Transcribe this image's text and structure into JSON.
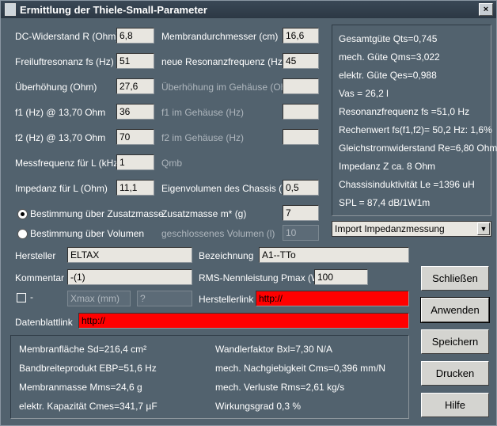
{
  "window": {
    "title": "Ermittlung der Thiele-Small-Parameter"
  },
  "left_fields": [
    {
      "label": "DC-Widerstand R (Ohm)",
      "value": "6,8"
    },
    {
      "label": "Freiluftresonanz fs (Hz)",
      "value": "51"
    },
    {
      "label": "Überhöhung (Ohm)",
      "value": "27,6"
    },
    {
      "label": "f1 (Hz) @ 13,70 Ohm",
      "value": "36"
    },
    {
      "label": "f2 (Hz) @ 13,70 Ohm",
      "value": "70"
    },
    {
      "label": "Messfrequenz für L (kHz)",
      "value": "1"
    },
    {
      "label": "Impedanz für L (Ohm)",
      "value": "11,1"
    }
  ],
  "mid_fields": [
    {
      "label": "Membrandurchmesser (cm)",
      "value": "16,6",
      "disabled": false
    },
    {
      "label": "neue Resonanzfrequenz (Hz)",
      "value": "45",
      "disabled": false
    },
    {
      "label": "Überhöhung im Gehäuse (Ohm)",
      "value": "",
      "disabled": true
    },
    {
      "label": "f1 im Gehäuse (Hz)",
      "value": "",
      "disabled": true
    },
    {
      "label": "f2 im Gehäuse (Hz)",
      "value": "",
      "disabled": true
    },
    {
      "label": "Qmb",
      "value": "",
      "disabled": true
    },
    {
      "label": "Eigenvolumen des Chassis (l)",
      "value": "0,5",
      "disabled": false
    }
  ],
  "results_right": [
    "Gesamtgüte Qts=0,745",
    "mech. Güte Qms=3,022",
    "elektr. Güte Qes=0,988",
    "Vas = 26,2 l",
    "Resonanzfrequenz fs =51,0 Hz",
    "Rechenwert fs(f1,f2)= 50,2 Hz: 1,6%",
    "Gleichstromwiderstand Re=6,80 Ohm",
    "Impedanz Z ca. 8 Ohm",
    "Chassisinduktivität Le =1396 uH",
    "SPL = 87,4 dB/1W1m"
  ],
  "radio": {
    "zusatz_label": "Bestimmung über Zusatzmasse",
    "volumen_label": "Bestimmung über Volumen",
    "zusatzmasse_label": "Zusatzmasse m* (g)",
    "zusatzmasse_value": "7",
    "volumen_field_label": "geschlossenes Volumen (l)",
    "volumen_field_value": "10"
  },
  "import_select": {
    "value": "Import Impedanzmessung"
  },
  "meta": {
    "hersteller_label": "Hersteller",
    "hersteller_value": "ELTAX",
    "bezeichnung_label": "Bezeichnung",
    "bezeichnung_value": "A1--TTo",
    "kommentar_label": "Kommentar",
    "kommentar_value": "-(1)",
    "rms_label": "RMS-Nennleistung Pmax (W)",
    "rms_value": "100",
    "check_label": "-",
    "xmax_placeholder": "Xmax (mm)",
    "q_placeholder": "?",
    "herstellerlink_label": "Herstellerlink",
    "herstellerlink_value": "http://",
    "datenblatt_label": "Datenblattlink",
    "datenblatt_value": "http://"
  },
  "bottom_results_left": [
    "Membranfläche Sd=216,4 cm²",
    "Bandbreiteprodukt EBP=51,6 Hz",
    "Membranmasse Mms=24,6 g",
    "elektr. Kapazität Cmes=341,7 µF"
  ],
  "bottom_results_right": [
    "Wandlerfaktor Bxl=7,30 N/A",
    "mech. Nachgiebigkeit Cms=0,396 mm/N",
    "mech. Verluste Rms=2,61 kg/s",
    "Wirkungsgrad 0,3 %"
  ],
  "buttons": {
    "close": "Schließen",
    "apply": "Anwenden",
    "save": "Speichern",
    "print": "Drucken",
    "help": "Hilfe"
  }
}
